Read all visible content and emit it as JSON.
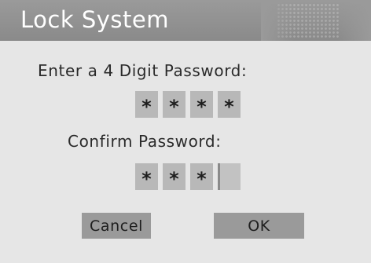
{
  "window": {
    "title": "Lock System"
  },
  "form": {
    "enter_label": "Enter a 4 Digit Password:",
    "confirm_label": "Confirm Password:",
    "password_digits": [
      "*",
      "*",
      "*",
      "*"
    ],
    "confirm_digits": [
      "*",
      "*",
      "*",
      ""
    ]
  },
  "buttons": {
    "cancel_label": "Cancel",
    "ok_label": "OK"
  },
  "colors": {
    "title_bar": "#8a8a8a",
    "background": "#e6e6e6",
    "digit_box": "#b8b8b8",
    "button": "#9a9a9a"
  }
}
